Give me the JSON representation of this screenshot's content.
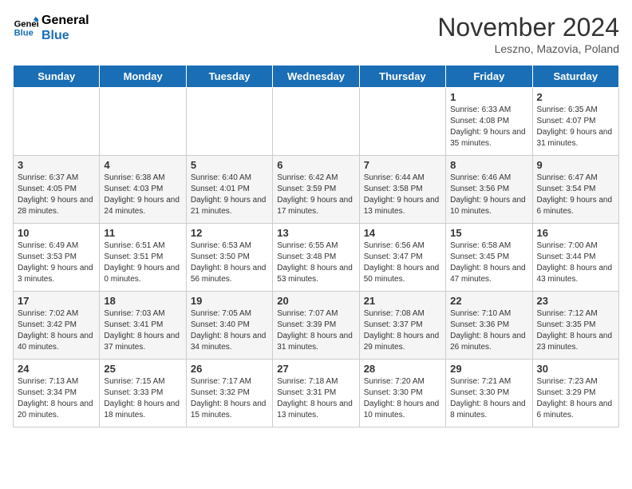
{
  "logo": {
    "line1": "General",
    "line2": "Blue"
  },
  "title": "November 2024",
  "subtitle": "Leszno, Mazovia, Poland",
  "headers": [
    "Sunday",
    "Monday",
    "Tuesday",
    "Wednesday",
    "Thursday",
    "Friday",
    "Saturday"
  ],
  "weeks": [
    [
      {
        "day": "",
        "info": ""
      },
      {
        "day": "",
        "info": ""
      },
      {
        "day": "",
        "info": ""
      },
      {
        "day": "",
        "info": ""
      },
      {
        "day": "",
        "info": ""
      },
      {
        "day": "1",
        "info": "Sunrise: 6:33 AM\nSunset: 4:08 PM\nDaylight: 9 hours and 35 minutes."
      },
      {
        "day": "2",
        "info": "Sunrise: 6:35 AM\nSunset: 4:07 PM\nDaylight: 9 hours and 31 minutes."
      }
    ],
    [
      {
        "day": "3",
        "info": "Sunrise: 6:37 AM\nSunset: 4:05 PM\nDaylight: 9 hours and 28 minutes."
      },
      {
        "day": "4",
        "info": "Sunrise: 6:38 AM\nSunset: 4:03 PM\nDaylight: 9 hours and 24 minutes."
      },
      {
        "day": "5",
        "info": "Sunrise: 6:40 AM\nSunset: 4:01 PM\nDaylight: 9 hours and 21 minutes."
      },
      {
        "day": "6",
        "info": "Sunrise: 6:42 AM\nSunset: 3:59 PM\nDaylight: 9 hours and 17 minutes."
      },
      {
        "day": "7",
        "info": "Sunrise: 6:44 AM\nSunset: 3:58 PM\nDaylight: 9 hours and 13 minutes."
      },
      {
        "day": "8",
        "info": "Sunrise: 6:46 AM\nSunset: 3:56 PM\nDaylight: 9 hours and 10 minutes."
      },
      {
        "day": "9",
        "info": "Sunrise: 6:47 AM\nSunset: 3:54 PM\nDaylight: 9 hours and 6 minutes."
      }
    ],
    [
      {
        "day": "10",
        "info": "Sunrise: 6:49 AM\nSunset: 3:53 PM\nDaylight: 9 hours and 3 minutes."
      },
      {
        "day": "11",
        "info": "Sunrise: 6:51 AM\nSunset: 3:51 PM\nDaylight: 9 hours and 0 minutes."
      },
      {
        "day": "12",
        "info": "Sunrise: 6:53 AM\nSunset: 3:50 PM\nDaylight: 8 hours and 56 minutes."
      },
      {
        "day": "13",
        "info": "Sunrise: 6:55 AM\nSunset: 3:48 PM\nDaylight: 8 hours and 53 minutes."
      },
      {
        "day": "14",
        "info": "Sunrise: 6:56 AM\nSunset: 3:47 PM\nDaylight: 8 hours and 50 minutes."
      },
      {
        "day": "15",
        "info": "Sunrise: 6:58 AM\nSunset: 3:45 PM\nDaylight: 8 hours and 47 minutes."
      },
      {
        "day": "16",
        "info": "Sunrise: 7:00 AM\nSunset: 3:44 PM\nDaylight: 8 hours and 43 minutes."
      }
    ],
    [
      {
        "day": "17",
        "info": "Sunrise: 7:02 AM\nSunset: 3:42 PM\nDaylight: 8 hours and 40 minutes."
      },
      {
        "day": "18",
        "info": "Sunrise: 7:03 AM\nSunset: 3:41 PM\nDaylight: 8 hours and 37 minutes."
      },
      {
        "day": "19",
        "info": "Sunrise: 7:05 AM\nSunset: 3:40 PM\nDaylight: 8 hours and 34 minutes."
      },
      {
        "day": "20",
        "info": "Sunrise: 7:07 AM\nSunset: 3:39 PM\nDaylight: 8 hours and 31 minutes."
      },
      {
        "day": "21",
        "info": "Sunrise: 7:08 AM\nSunset: 3:37 PM\nDaylight: 8 hours and 29 minutes."
      },
      {
        "day": "22",
        "info": "Sunrise: 7:10 AM\nSunset: 3:36 PM\nDaylight: 8 hours and 26 minutes."
      },
      {
        "day": "23",
        "info": "Sunrise: 7:12 AM\nSunset: 3:35 PM\nDaylight: 8 hours and 23 minutes."
      }
    ],
    [
      {
        "day": "24",
        "info": "Sunrise: 7:13 AM\nSunset: 3:34 PM\nDaylight: 8 hours and 20 minutes."
      },
      {
        "day": "25",
        "info": "Sunrise: 7:15 AM\nSunset: 3:33 PM\nDaylight: 8 hours and 18 minutes."
      },
      {
        "day": "26",
        "info": "Sunrise: 7:17 AM\nSunset: 3:32 PM\nDaylight: 8 hours and 15 minutes."
      },
      {
        "day": "27",
        "info": "Sunrise: 7:18 AM\nSunset: 3:31 PM\nDaylight: 8 hours and 13 minutes."
      },
      {
        "day": "28",
        "info": "Sunrise: 7:20 AM\nSunset: 3:30 PM\nDaylight: 8 hours and 10 minutes."
      },
      {
        "day": "29",
        "info": "Sunrise: 7:21 AM\nSunset: 3:30 PM\nDaylight: 8 hours and 8 minutes."
      },
      {
        "day": "30",
        "info": "Sunrise: 7:23 AM\nSunset: 3:29 PM\nDaylight: 8 hours and 6 minutes."
      }
    ]
  ]
}
